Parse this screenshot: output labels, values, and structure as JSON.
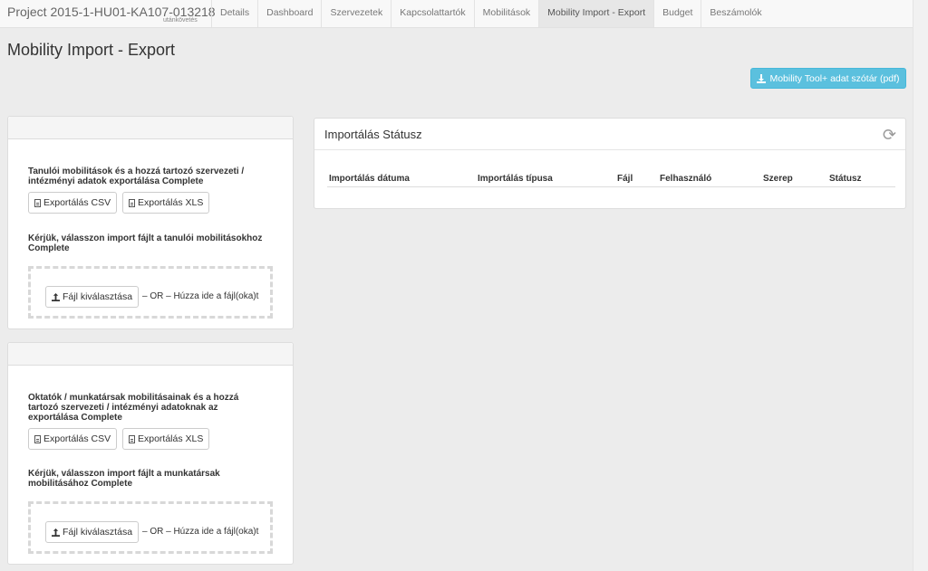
{
  "nav": {
    "brand": "Project 2015-1-HU01-KA107-013218",
    "brand_sub": "utánkövetés",
    "tabs": [
      {
        "label": "Details"
      },
      {
        "label": "Dashboard"
      },
      {
        "label": "Szervezetek"
      },
      {
        "label": "Kapcsolattartók"
      },
      {
        "label": "Mobilitások"
      },
      {
        "label": "Mobility Import - Export"
      },
      {
        "label": "Budget"
      },
      {
        "label": "Beszámolók"
      }
    ],
    "active_tab": "Mobility Import - Export"
  },
  "page": {
    "title": "Mobility Import - Export",
    "dictionary_button": "Mobility Tool+ adat szótár (pdf)",
    "accent_color": "#5bc0de"
  },
  "students": {
    "export_text": "Tanulói mobilitások és a hozzá tartozó szervezeti / intézményi adatok exportálása Complete",
    "export_csv": "Exportálás CSV",
    "export_xls": "Exportálás XLS",
    "import_text": "Kérjük, válasszon import fájlt a tanulói mobilitásokhoz Complete",
    "choose_file": "Fájl kiválasztása",
    "drop_hint": "– OR – Húzza ide a fájl(oka)t"
  },
  "staff": {
    "export_text": "Oktatók / munkatársak mobilitásainak és a hozzá tartozó szervezeti / intézményi adatoknak az exportálása Complete",
    "export_csv": "Exportálás CSV",
    "export_xls": "Exportálás XLS",
    "import_text": "Kérjük, válasszon import fájlt a munkatársak mobilitásához Complete",
    "choose_file": "Fájl kiválasztása",
    "drop_hint": "– OR – Húzza ide a fájl(oka)t"
  },
  "status": {
    "title": "Importálás Státusz",
    "refresh_icon": "refresh-icon",
    "columns": [
      "Importálás dátuma",
      "Importálás típusa",
      "Fájl",
      "Felhasználó",
      "Szerep",
      "Státusz"
    ]
  }
}
